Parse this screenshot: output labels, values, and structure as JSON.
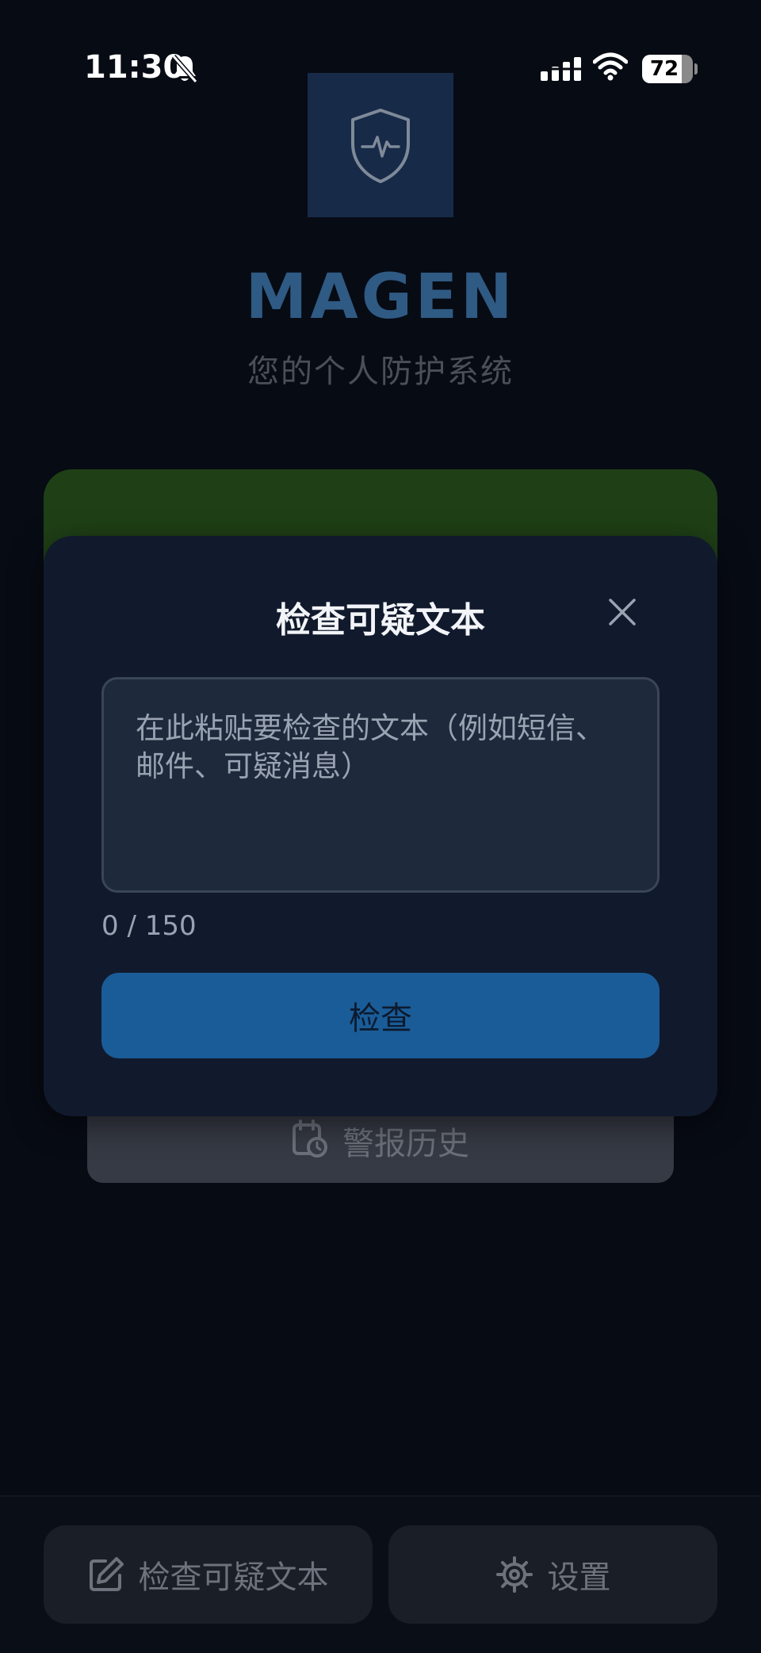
{
  "status_bar": {
    "time": "11:30",
    "battery": "72",
    "icons": [
      "bell-slash-icon",
      "signal-icon",
      "wifi-icon",
      "battery-icon"
    ]
  },
  "app": {
    "name": "MAGEN",
    "subtitle": "您的个人防护系统",
    "logo_icon": "shield-heartbeat-icon",
    "accent_color": "#1a5c98"
  },
  "background": {
    "history_button": {
      "label": "警报历史",
      "icon": "calendar-clock-icon"
    }
  },
  "modal": {
    "title": "检查可疑文本",
    "close_icon": "close-icon",
    "input": {
      "value": "",
      "placeholder": "在此粘贴要检查的文本（例如短信、邮件、可疑消息）"
    },
    "char_count": "0 / 150",
    "submit_label": "检查"
  },
  "bottom_nav": {
    "items": [
      {
        "label": "检查可疑文本",
        "icon": "edit-icon"
      },
      {
        "label": "设置",
        "icon": "gear-icon"
      }
    ]
  }
}
